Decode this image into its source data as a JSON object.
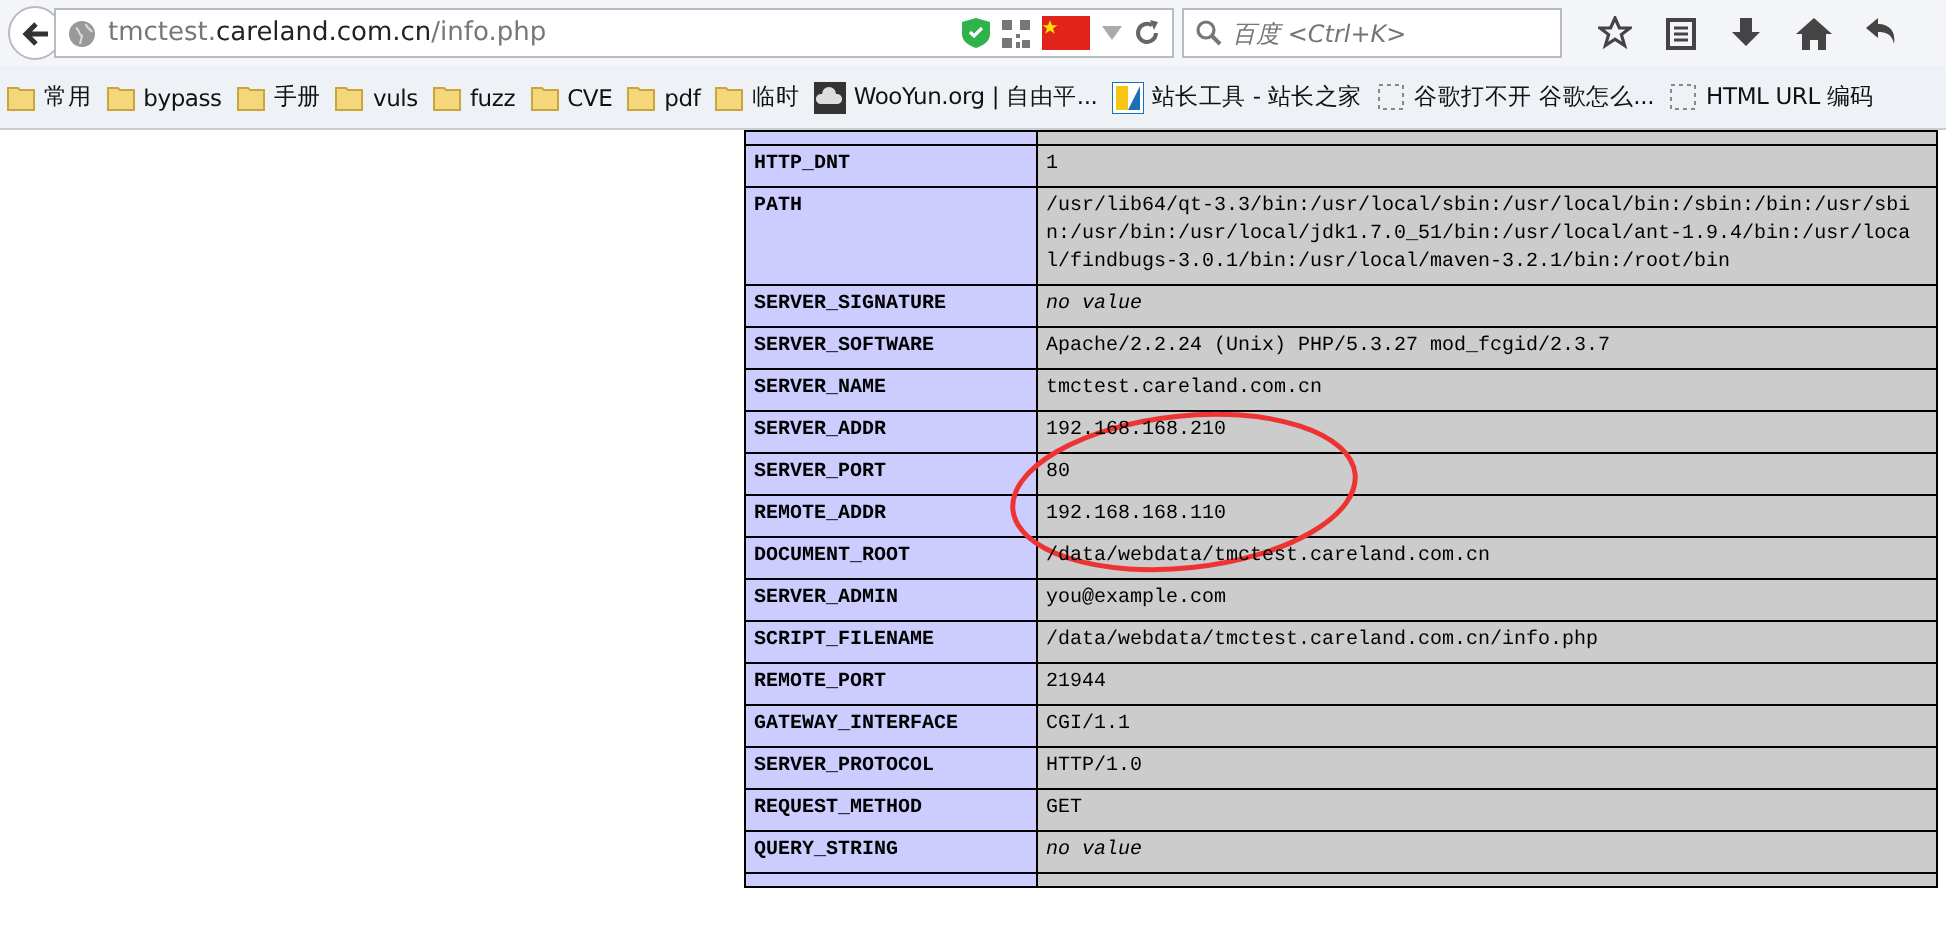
{
  "browser": {
    "url": {
      "subdomain": "tmctest.",
      "domain": "careland.com.cn",
      "path": "/info.php"
    },
    "search": {
      "placeholder": "百度 <Ctrl+K>"
    },
    "bookmarks": [
      {
        "kind": "folder",
        "label": "常用"
      },
      {
        "kind": "folder",
        "label": "bypass"
      },
      {
        "kind": "folder",
        "label": "手册"
      },
      {
        "kind": "folder",
        "label": "vuls"
      },
      {
        "kind": "folder",
        "label": "fuzz"
      },
      {
        "kind": "folder",
        "label": "CVE"
      },
      {
        "kind": "folder",
        "label": "pdf"
      },
      {
        "kind": "folder",
        "label": "临时"
      },
      {
        "kind": "cloud",
        "label": "WooYun.org | 自由平..."
      },
      {
        "kind": "logo",
        "label": "站长工具 - 站长之家"
      },
      {
        "kind": "page",
        "label": "谷歌打不开 谷歌怎么..."
      },
      {
        "kind": "page",
        "label": "HTML URL 编码"
      }
    ]
  },
  "table": {
    "rows": [
      {
        "kind": "stub"
      },
      {
        "kind": "text",
        "key": "HTTP_DNT",
        "value": "1"
      },
      {
        "kind": "text",
        "key": "PATH",
        "value": "/usr/lib64/qt-3.3/bin:/usr/local/sbin:/usr/local/bin:/sbin:/bin:/usr/sbin:/usr/bin:/usr/local/jdk1.7.0_51/bin:/usr/local/ant-1.9.4/bin:/usr/local/findbugs-3.0.1/bin:/usr/local/maven-3.2.1/bin:/root/bin"
      },
      {
        "kind": "none",
        "key": "SERVER_SIGNATURE",
        "value": "no value"
      },
      {
        "kind": "text",
        "key": "SERVER_SOFTWARE",
        "value": "Apache/2.2.24 (Unix) PHP/5.3.27 mod_fcgid/2.3.7"
      },
      {
        "kind": "text",
        "key": "SERVER_NAME",
        "value": "tmctest.careland.com.cn"
      },
      {
        "kind": "text",
        "key": "SERVER_ADDR",
        "value": "192.168.168.210"
      },
      {
        "kind": "text",
        "key": "SERVER_PORT",
        "value": "80"
      },
      {
        "kind": "text",
        "key": "REMOTE_ADDR",
        "value": "192.168.168.110"
      },
      {
        "kind": "text",
        "key": "DOCUMENT_ROOT",
        "value": "/data/webdata/tmctest.careland.com.cn"
      },
      {
        "kind": "text",
        "key": "SERVER_ADMIN",
        "value": "you@example.com"
      },
      {
        "kind": "text",
        "key": "SCRIPT_FILENAME",
        "value": "/data/webdata/tmctest.careland.com.cn/info.php"
      },
      {
        "kind": "text",
        "key": "REMOTE_PORT",
        "value": "21944"
      },
      {
        "kind": "text",
        "key": "GATEWAY_INTERFACE",
        "value": "CGI/1.1"
      },
      {
        "kind": "text",
        "key": "SERVER_PROTOCOL",
        "value": "HTTP/1.0"
      },
      {
        "kind": "text",
        "key": "REQUEST_METHOD",
        "value": "GET"
      },
      {
        "kind": "none",
        "key": "QUERY_STRING",
        "value": "no value"
      },
      {
        "kind": "stub"
      }
    ]
  }
}
